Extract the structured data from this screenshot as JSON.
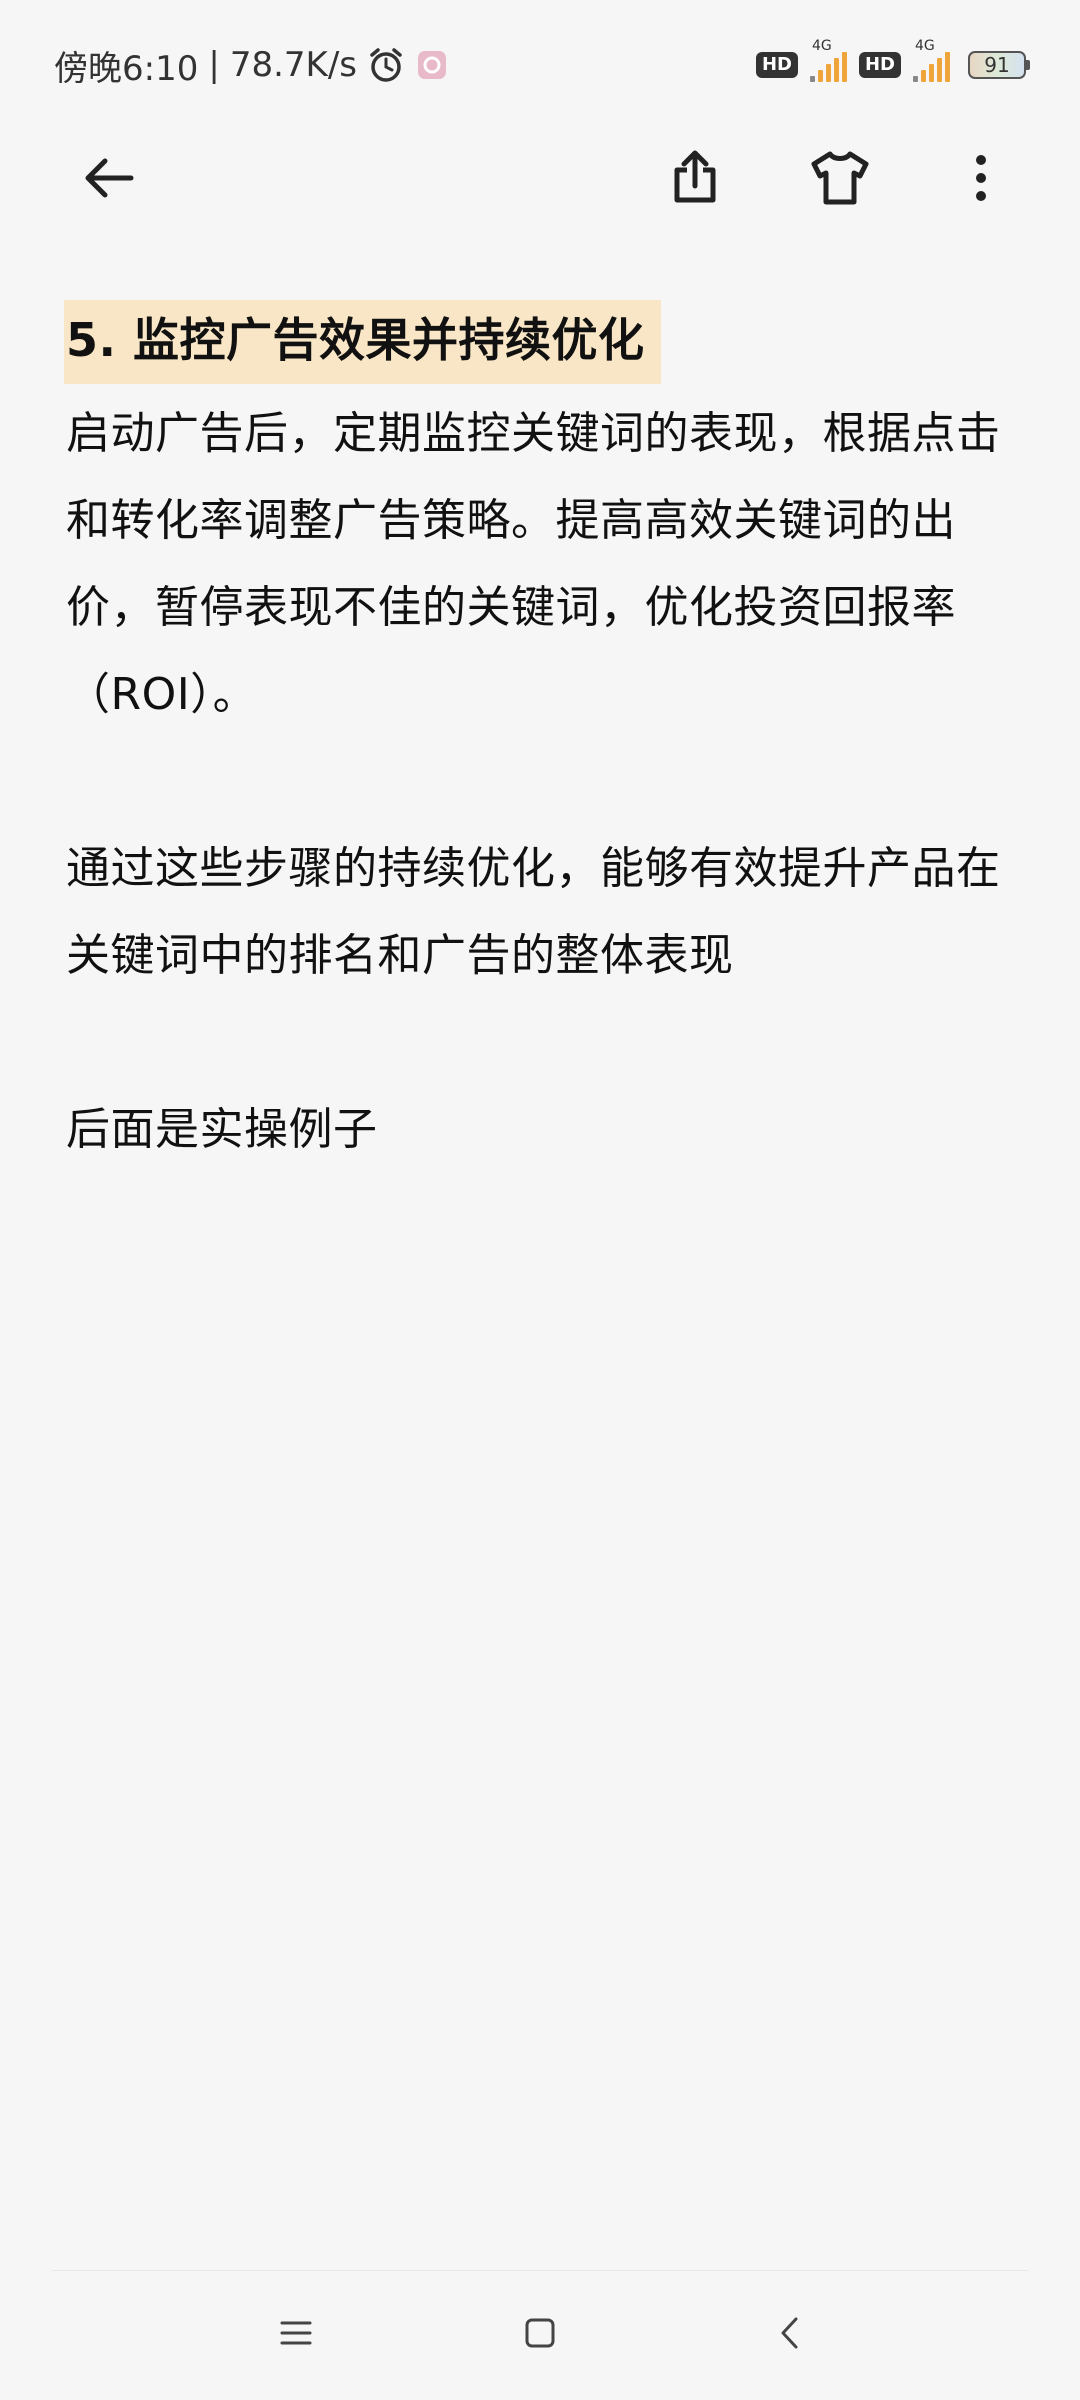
{
  "status_bar": {
    "time": "傍晚6:10",
    "separator": "|",
    "net_speed": "78.7K/s",
    "hd1": "HD",
    "net1": "4G",
    "hd2": "HD",
    "net2": "4G",
    "battery": "91",
    "icons": [
      "alarm-icon",
      "app-notification-icon",
      "signal-icon",
      "battery-icon"
    ]
  },
  "toolbar": {
    "icons": [
      "arrow-left-icon",
      "share-icon",
      "tshirt-icon",
      "more-vertical-icon"
    ]
  },
  "note": {
    "heading": "5. 监控广告效果并持续优化",
    "paragraph1": "启动广告后，定期监控关键词的表现，根据点击和转化率调整广告策略。提高高效关键词的出价，暂停表现不佳的关键词，优化投资回报率（ROI）。",
    "paragraph2": "通过这些步骤的持续优化，能够有效提升产品在关键词中的排名和广告的整体表现",
    "paragraph3": "后面是实操例子"
  },
  "nav_bar": {
    "icons": [
      "menu-icon",
      "home-square-icon",
      "back-chevron-icon"
    ]
  },
  "colors": {
    "background": "#f6f6f6",
    "heading_highlight": "#f8e6c6",
    "signal": "#f0a53a",
    "text": "#111111"
  }
}
